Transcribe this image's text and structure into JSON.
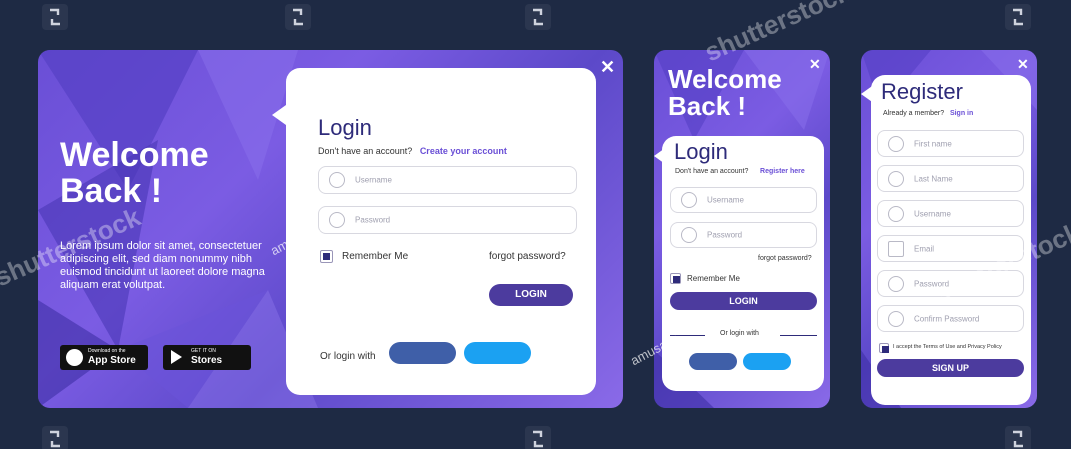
{
  "colors": {
    "background": "#1e2a44",
    "panel_accent": "#6a4fd6",
    "title": "#2e2b7a",
    "primary_button": "#4c3b9e",
    "facebook": "#3f5fa8",
    "twitter": "#1ba1f2"
  },
  "watermark": {
    "brand": "shutterstock",
    "author": "amusava"
  },
  "desktop": {
    "close_symbol": "✕",
    "welcome_line1": "Welcome",
    "welcome_line2": "Back !",
    "lorem": "Lorem ipsum dolor sit amet, consectetuer adipiscing elit, sed diam nonummy nibh euismod tincidunt ut laoreet dolore magna aliquam erat volutpat.",
    "app_store": {
      "small": "Download on the",
      "big": "App Store",
      "icon": "apple-icon"
    },
    "play_store": {
      "small": "GET IT ON",
      "big": "Stores",
      "icon": "play-icon"
    },
    "login": {
      "title": "Login",
      "no_account": "Don't have an account?",
      "create_link": "Create your account",
      "username_placeholder": "Username",
      "password_placeholder": "Password",
      "remember": "Remember Me",
      "forgot": "forgot password?",
      "button": "LOGIN",
      "or_login_with": "Or login with"
    }
  },
  "mobile_login": {
    "close_symbol": "✕",
    "welcome_line1": "Welcome",
    "welcome_line2": "Back !",
    "title": "Login",
    "no_account": "Don't have an account?",
    "register_link": "Register here",
    "username_placeholder": "Username",
    "password_placeholder": "Password",
    "forgot": "forgot password?",
    "remember": "Remember Me",
    "button": "LOGIN",
    "or_login_with": "Or login with"
  },
  "mobile_register": {
    "close_symbol": "✕",
    "title": "Register",
    "already": "Already a member?",
    "sign_in_link": "Sign in",
    "fields": [
      "First name",
      "Last Name",
      "Username",
      "Email",
      "Password",
      "Confirm Password"
    ],
    "terms": "I accept the Terms of Use and Privacy Policy",
    "button": "SIGN UP"
  }
}
